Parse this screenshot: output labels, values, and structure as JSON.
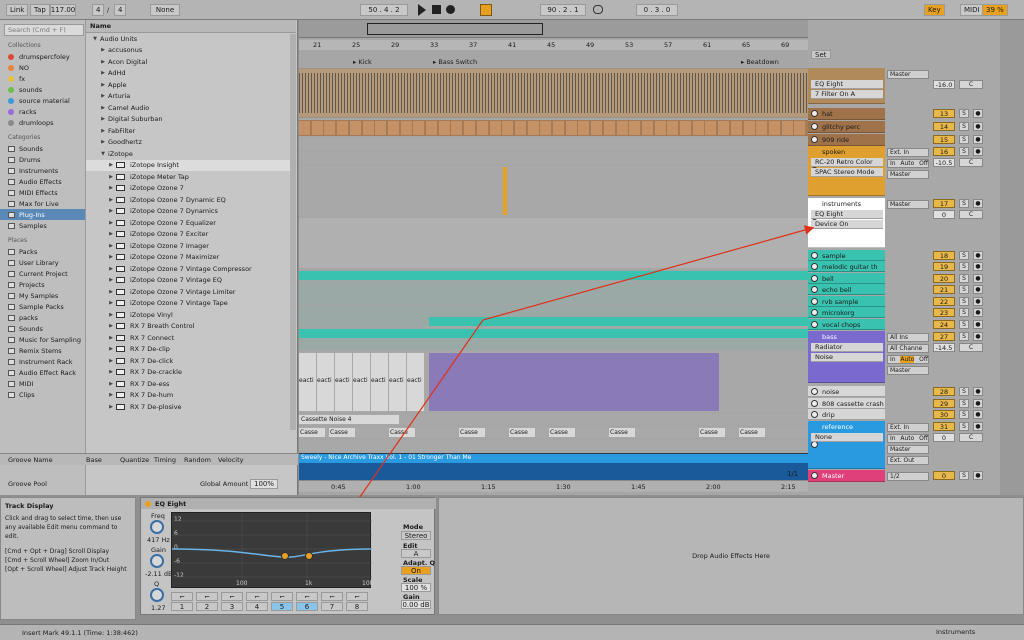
{
  "transport": {
    "link": "Link",
    "tap": "Tap",
    "tempo": "117.00",
    "meter_num": "4",
    "meter_den": "4",
    "quantize": "None",
    "position": "50 .   4 .   2",
    "loop_start": "90 .   2 .   1",
    "loop_len": "0 .   3 .   0",
    "key": "Key",
    "midi": "MIDI",
    "cpu": "39 %"
  },
  "browser": {
    "search_placeholder": "Search (Cmd + F)",
    "collections_header": "Collections",
    "collections": [
      {
        "label": "drumspercfoley",
        "color": "#d94a3a"
      },
      {
        "label": "NO",
        "color": "#e8853a"
      },
      {
        "label": "fx",
        "color": "#e8c13a"
      },
      {
        "label": "sounds",
        "color": "#6cbf4a"
      },
      {
        "label": "source material",
        "color": "#3a9ad9"
      },
      {
        "label": "racks",
        "color": "#9a6ad9"
      },
      {
        "label": "drumloops",
        "color": "#8a8a8a"
      }
    ],
    "categories_header": "Categories",
    "categories": [
      "Sounds",
      "Drums",
      "Instruments",
      "Audio Effects",
      "MIDI Effects",
      "Max for Live",
      "Plug-Ins",
      "Samples"
    ],
    "selected_category": "Plug-Ins",
    "places_header": "Places",
    "places": [
      "Packs",
      "User Library",
      "Current Project",
      "Projects",
      "My Samples",
      "Sample Packs",
      "packs",
      "Sounds",
      "Music for Sampling",
      "Remix Stems",
      "Instrument Rack",
      "Audio Effect Rack",
      "MIDI",
      "Clips"
    ],
    "name_header": "Name",
    "items": [
      {
        "label": "Audio Units",
        "indent": 0,
        "kind": "folder"
      },
      {
        "label": "accusonus",
        "indent": 1,
        "kind": "folder"
      },
      {
        "label": "Acon Digital",
        "indent": 1,
        "kind": "folder"
      },
      {
        "label": "AdHd",
        "indent": 1,
        "kind": "folder"
      },
      {
        "label": "Apple",
        "indent": 1,
        "kind": "folder"
      },
      {
        "label": "Arturia",
        "indent": 1,
        "kind": "folder"
      },
      {
        "label": "Camel Audio",
        "indent": 1,
        "kind": "folder"
      },
      {
        "label": "Digital Suburban",
        "indent": 1,
        "kind": "folder"
      },
      {
        "label": "FabFilter",
        "indent": 1,
        "kind": "folder"
      },
      {
        "label": "Goodhertz",
        "indent": 1,
        "kind": "folder"
      },
      {
        "label": "iZotope",
        "indent": 1,
        "kind": "open"
      },
      {
        "label": "iZotope Insight",
        "indent": 2,
        "kind": "plugin",
        "selected": true
      },
      {
        "label": "iZotope Meter Tap",
        "indent": 2,
        "kind": "plugin"
      },
      {
        "label": "iZotope Ozone 7",
        "indent": 2,
        "kind": "plugin"
      },
      {
        "label": "iZotope Ozone 7 Dynamic EQ",
        "indent": 2,
        "kind": "plugin"
      },
      {
        "label": "iZotope Ozone 7 Dynamics",
        "indent": 2,
        "kind": "plugin"
      },
      {
        "label": "iZotope Ozone 7 Equalizer",
        "indent": 2,
        "kind": "plugin"
      },
      {
        "label": "iZotope Ozone 7 Exciter",
        "indent": 2,
        "kind": "plugin"
      },
      {
        "label": "iZotope Ozone 7 Imager",
        "indent": 2,
        "kind": "plugin"
      },
      {
        "label": "iZotope Ozone 7 Maximizer",
        "indent": 2,
        "kind": "plugin"
      },
      {
        "label": "iZotope Ozone 7 Vintage Compressor",
        "indent": 2,
        "kind": "plugin"
      },
      {
        "label": "iZotope Ozone 7 Vintage EQ",
        "indent": 2,
        "kind": "plugin"
      },
      {
        "label": "iZotope Ozone 7 Vintage Limiter",
        "indent": 2,
        "kind": "plugin"
      },
      {
        "label": "iZotope Ozone 7 Vintage Tape",
        "indent": 2,
        "kind": "plugin"
      },
      {
        "label": "iZotope Vinyl",
        "indent": 2,
        "kind": "plugin"
      },
      {
        "label": "RX 7 Breath Control",
        "indent": 2,
        "kind": "plugin"
      },
      {
        "label": "RX 7 Connect",
        "indent": 2,
        "kind": "plugin"
      },
      {
        "label": "RX 7 De-clip",
        "indent": 2,
        "kind": "plugin"
      },
      {
        "label": "RX 7 De-click",
        "indent": 2,
        "kind": "plugin"
      },
      {
        "label": "RX 7 De-crackle",
        "indent": 2,
        "kind": "plugin"
      },
      {
        "label": "RX 7 De-ess",
        "indent": 2,
        "kind": "plugin"
      },
      {
        "label": "RX 7 De-hum",
        "indent": 2,
        "kind": "plugin"
      },
      {
        "label": "RX 7 De-plosive",
        "indent": 2,
        "kind": "plugin"
      }
    ],
    "groove": {
      "name": "Groove Name",
      "base": "Base",
      "quantize": "Quantize",
      "timing": "Timing",
      "random": "Random",
      "velocity": "Velocity",
      "pool": "Groove Pool",
      "global_amount_label": "Global Amount",
      "global_amount": "100%"
    }
  },
  "arrangement": {
    "bars": [
      "21",
      "25",
      "29",
      "33",
      "37",
      "41",
      "45",
      "49",
      "53",
      "57",
      "61",
      "65",
      "69"
    ],
    "locators": [
      "Kick",
      "Bass Switch",
      "Beatdown"
    ],
    "clip_noise": "Cassette Noise 4",
    "clip_cass": "Casse",
    "clip_react": "eacti",
    "clip_reference": "Sweely - Nice Archive Traxx Vol. 1 - 01 Stronger Than Me",
    "times": [
      "0:45",
      "1:00",
      "1:15",
      "1:30",
      "1:45",
      "2:00",
      "2:15"
    ],
    "zoom": "1/1",
    "set_label": "Set"
  },
  "mixer": {
    "tracks": [
      {
        "name": "",
        "color": "#b08a5a",
        "num": "",
        "devs": [
          "EQ Eight",
          "7 Filter On A"
        ],
        "io": "Master",
        "vol": "-16.0",
        "pan": "C"
      },
      {
        "name": "hat",
        "color": "#a0724a",
        "num": "13"
      },
      {
        "name": "glitchy perc",
        "color": "#a0724a",
        "num": "14"
      },
      {
        "name": "909 ride",
        "color": "#a0724a",
        "num": "15"
      },
      {
        "name": "spoken",
        "color": "#e0a030",
        "num": "16",
        "devs": [
          "RC-20 Retro Color",
          "SPAC Stereo Mode"
        ],
        "io_in": "Ext. In",
        "io": "Master",
        "vol": "-10.5",
        "pan": "C"
      },
      {
        "name": "instruments",
        "color": "#ffffff",
        "num": "17",
        "devs": [
          "EQ Eight",
          "Device On"
        ],
        "io": "Master",
        "vol": "0",
        "pan": "C"
      },
      {
        "name": "sample",
        "color": "#3ac2b0",
        "num": "18"
      },
      {
        "name": "melodic guitar th",
        "color": "#3ac2b0",
        "num": "19"
      },
      {
        "name": "bell",
        "color": "#3ac2b0",
        "num": "20"
      },
      {
        "name": "echo bell",
        "color": "#3ac2b0",
        "num": "21"
      },
      {
        "name": "rvb sample",
        "color": "#3ac2b0",
        "num": "22"
      },
      {
        "name": "microkorg",
        "color": "#3ac2b0",
        "num": "23"
      },
      {
        "name": "vocal chops",
        "color": "#3ac2b0",
        "num": "24"
      },
      {
        "name": "bass",
        "color": "#7a6ad0",
        "num": "27",
        "devs": [
          "Radiator",
          "Noise"
        ],
        "io_in": "All Ins",
        "io_ch": "All Channe",
        "io": "Master",
        "vol": "-14.5",
        "pan": "C"
      },
      {
        "name": "noise",
        "color": "#d6d6d6",
        "num": "28"
      },
      {
        "name": "808 cassette crash",
        "color": "#d6d6d6",
        "num": "29"
      },
      {
        "name": "drip",
        "color": "#d6d6d6",
        "num": "30"
      },
      {
        "name": "reference",
        "color": "#2a9ae0",
        "num": "31",
        "devs": [
          "None"
        ],
        "io_in": "Ext. In",
        "io": "Master",
        "vol": "0",
        "pan": "C"
      },
      {
        "name": "Master",
        "color": "#e0407a",
        "num": "0",
        "io": "1/2"
      }
    ],
    "monitor": {
      "in": "In",
      "auto": "Auto",
      "off": "Off"
    },
    "ext_out": "Ext. Out",
    "solo": "S"
  },
  "info": {
    "title": "Track Display",
    "body": "Click and drag to select time, then use any available Edit menu command to edit.",
    "shortcuts": [
      "[Cmd + Opt + Drag] Scroll Display",
      "[Cmd + Scroll Wheel] Zoom In/Out",
      "[Opt + Scroll Wheel] Adjust Track Height"
    ]
  },
  "device": {
    "name": "EQ Eight",
    "freq_label": "Freq",
    "freq": "417 Hz",
    "gain_label": "Gain",
    "gain": "-2.11 dB",
    "q_label": "Q",
    "q": "1.27",
    "db_ticks": [
      "12",
      "6",
      "0",
      "-6",
      "-12"
    ],
    "freq_ticks": [
      "100",
      "1k",
      "10k"
    ],
    "mode_label": "Mode",
    "mode": "Stereo",
    "edit_label": "Edit",
    "edit": "A",
    "adapt_label": "Adapt. Q",
    "adapt": "On",
    "scale_label": "Scale",
    "scale": "100 %",
    "out_gain_label": "Gain",
    "out_gain": "0.00 dB",
    "bands": [
      "1",
      "2",
      "3",
      "4",
      "5",
      "6",
      "7",
      "8"
    ],
    "curve_color": "#6ab4e8"
  },
  "drop_hint": "Drop Audio Effects Here",
  "status": {
    "text": "Insert Mark 49.1.1 (Time: 1:38:462)",
    "right": "Instruments"
  },
  "annotation_color": "#e0301a"
}
